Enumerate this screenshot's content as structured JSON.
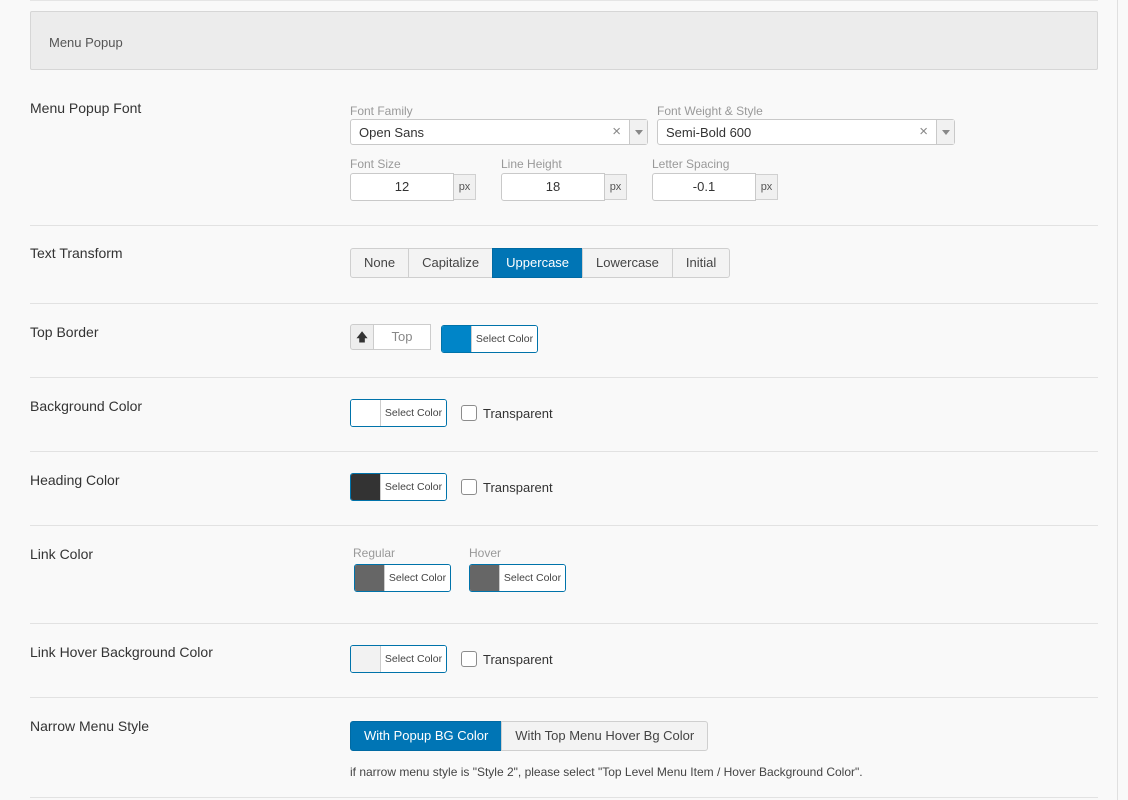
{
  "section": {
    "title": "Menu Popup"
  },
  "font": {
    "label": "Menu Popup Font",
    "family_label": "Font Family",
    "family_value": "Open Sans",
    "weight_label": "Font Weight & Style",
    "weight_value": "Semi-Bold 600",
    "size_label": "Font Size",
    "size_value": "12",
    "line_label": "Line Height",
    "line_value": "18",
    "spacing_label": "Letter Spacing",
    "spacing_value": "-0.1",
    "unit": "px",
    "clear_glyph": "×"
  },
  "transform": {
    "label": "Text Transform",
    "options": [
      "None",
      "Capitalize",
      "Uppercase",
      "Lowercase",
      "Initial"
    ],
    "selected": "Uppercase"
  },
  "top_border": {
    "label": "Top Border",
    "direction": "Top",
    "arrow_glyph": "🡅",
    "picker_label": "Select Color",
    "color": "#0085c8"
  },
  "background": {
    "label": "Background Color",
    "picker_label": "Select Color",
    "color": "#ffffff",
    "transparent_label": "Transparent"
  },
  "heading": {
    "label": "Heading Color",
    "picker_label": "Select Color",
    "color": "#333333",
    "transparent_label": "Transparent"
  },
  "link": {
    "label": "Link Color",
    "regular_label": "Regular",
    "regular_picker": "Select Color",
    "regular_color": "#666666",
    "hover_label": "Hover",
    "hover_picker": "Select Color",
    "hover_color": "#666666"
  },
  "link_hover_bg": {
    "label": "Link Hover Background Color",
    "picker_label": "Select Color",
    "color": "#f2f2f2",
    "transparent_label": "Transparent"
  },
  "narrow": {
    "label": "Narrow Menu Style",
    "options": [
      "With Popup BG Color",
      "With Top Menu Hover Bg Color"
    ],
    "selected": "With Popup BG Color",
    "help": "if narrow menu style is \"Style 2\", please select \"Top Level Menu Item / Hover Background Color\"."
  },
  "colors": {
    "accent": "#0075b5"
  }
}
